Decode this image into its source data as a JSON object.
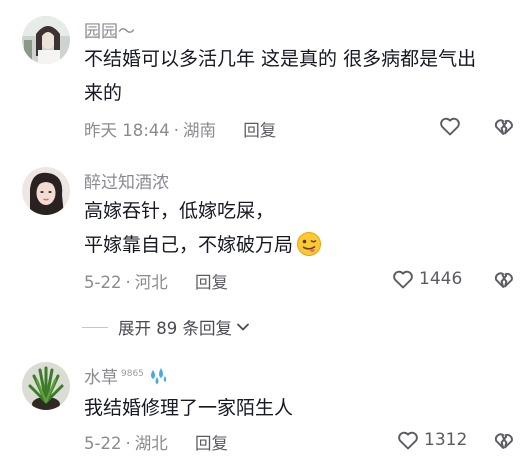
{
  "comments": [
    {
      "username": "园园～",
      "text_lines": [
        "不结婚可以多活几年 这是真的 很多病都是气出",
        "来的"
      ],
      "time": "昨天 18:44",
      "location": "湖南",
      "reply_label": "回复",
      "like_count": ""
    },
    {
      "username": "醉过知酒浓",
      "text_lines": [
        "高嫁吞针，低嫁吃屎，",
        "平嫁靠自己，不嫁破万局"
      ],
      "time": "5-22",
      "location": "河北",
      "reply_label": "回复",
      "like_count": "1446"
    },
    {
      "username": "水草",
      "username_sup": "9865",
      "text_lines": [
        "我结婚修理了一家陌生人"
      ],
      "time": "5-22",
      "location": "湖北",
      "reply_label": "回复",
      "like_count": "1312"
    }
  ],
  "expand_label": "展开 89 条回复",
  "icons": {
    "like": "heart-outline-icon",
    "dislike": "broken-heart-outline-icon",
    "expand": "chevron-down-icon",
    "emoji": "tongue-emoji-icon",
    "sweat": "sweat-drops-icon"
  }
}
